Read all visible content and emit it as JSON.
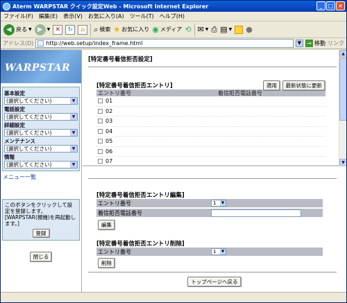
{
  "window": {
    "title": "Aterm WARPSTAR クイック設定Web - Microsoft Internet Explorer"
  },
  "menubar": [
    "ファイル(F)",
    "編集(E)",
    "表示(V)",
    "お気に入り(A)",
    "ツール(T)",
    "ヘルプ(H)"
  ],
  "toolbar": {
    "back": "戻る",
    "search": "検索",
    "favorites": "お気に入り",
    "media": "メディア"
  },
  "address": {
    "label": "アドレス(D)",
    "url": "http://web.setup/index_frame.html",
    "go": "移動",
    "links": "リンク"
  },
  "sidebar": {
    "logo": "WARPSTAR",
    "groups": [
      {
        "label": "基本設定",
        "value": "(選択してください)"
      },
      {
        "label": "電話設定",
        "value": "(選択してください)"
      },
      {
        "label": "詳細設定",
        "value": "(選択してください)"
      },
      {
        "label": "メンテナンス",
        "value": "(選択してください)"
      },
      {
        "label": "情報",
        "value": "(選択してください)"
      }
    ],
    "menu_list": "メニュー一覧",
    "info_text": "このボタンをクリックして設定を登録します。[WARPSTAR(親機)を再起動します。]",
    "register_button": "登録",
    "close_button": "閉じる"
  },
  "main": {
    "page_title": "[特定番号着信拒否設定]",
    "entry": {
      "title": "[特定番号着信拒否エントリ]",
      "apply_button": "適用",
      "refresh_button": "最新状態に更新",
      "col_entry": "エントリ番号",
      "col_phone": "着信拒否電話番号",
      "rows": [
        "01",
        "02",
        "03",
        "04",
        "05",
        "06",
        "07"
      ]
    },
    "edit": {
      "title": "[特定番号着信拒否エントリ編集]",
      "entry_label": "エントリ番号",
      "entry_value": "1",
      "phone_label": "着信拒否電話番号",
      "edit_button": "編集"
    },
    "delete": {
      "title": "[特定番号着信拒否エントリ削除]",
      "entry_label": "エントリ番号",
      "entry_value": "1",
      "delete_button": "削除"
    },
    "top_button": "トップページへ戻る"
  }
}
